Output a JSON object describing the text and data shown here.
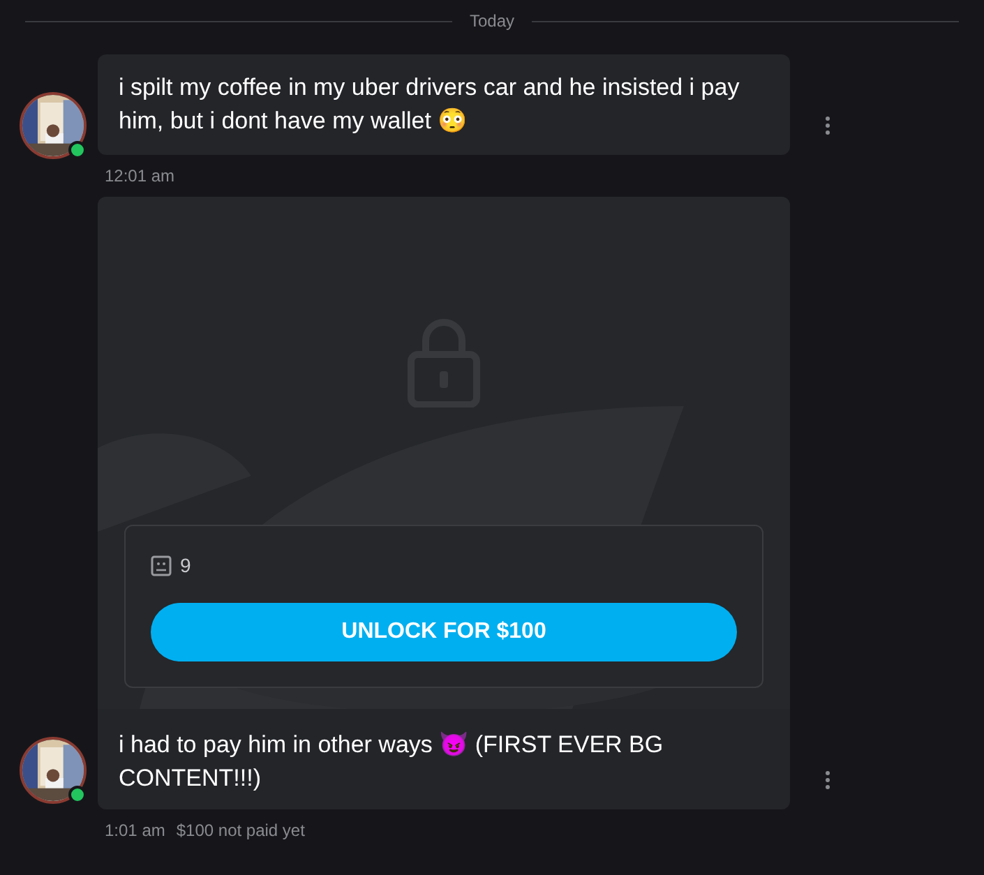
{
  "divider": {
    "label": "Today"
  },
  "messages": [
    {
      "kind": "text",
      "text": "i spilt my coffee in my uber drivers car and he insisted i pay him, but i dont have my wallet 😳",
      "online": true,
      "meta": [
        "12:01 am"
      ]
    },
    {
      "kind": "locked",
      "media_count": "9",
      "button": "UNLOCK FOR $100",
      "text": "i had to pay him in other ways 😈 (FIRST EVER BG CONTENT!!!)",
      "online": true,
      "meta": [
        "1:01 am",
        "$100 not paid yet"
      ]
    }
  ]
}
